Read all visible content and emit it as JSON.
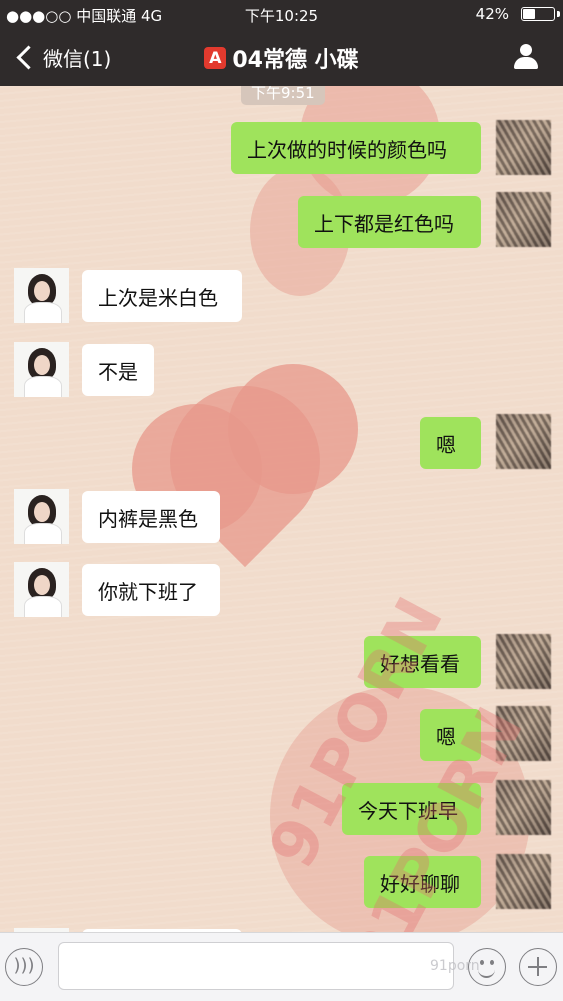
{
  "status_bar": {
    "carrier": "●●●○○ 中国联通   4G",
    "time": "下午10:25",
    "battery": "42%",
    "battery_level": 0.42
  },
  "nav": {
    "back_label": "微信(1)",
    "badge": "A",
    "title": "04常德 小碟"
  },
  "chat": {
    "timestamp": "下午9:51",
    "messages": [
      {
        "side": "out",
        "text": "上次做的时候的颜色吗"
      },
      {
        "side": "out",
        "text": "上下都是红色吗"
      },
      {
        "side": "in",
        "text": "上次是米白色"
      },
      {
        "side": "in",
        "text": "不是"
      },
      {
        "side": "out",
        "text": "嗯"
      },
      {
        "side": "in",
        "text": "内裤是黑色"
      },
      {
        "side": "in",
        "text": "你就下班了"
      },
      {
        "side": "out",
        "text": "好想看看"
      },
      {
        "side": "out",
        "text": "嗯"
      },
      {
        "side": "out",
        "text": "今天下班早"
      },
      {
        "side": "out",
        "text": "好好聊聊"
      }
    ]
  },
  "watermark": {
    "text1": "91PORN",
    "text2": "91PORN",
    "small": "91porn"
  },
  "icons": {
    "back": "chevron-left-icon",
    "profile": "person-icon",
    "voice": "voice-icon",
    "emoji": "emoji-icon",
    "add": "plus-icon"
  },
  "colors": {
    "outgoing_bubble": "#9fe35c",
    "incoming_bubble": "#ffffff",
    "nav_bg": "#2f2b2b"
  }
}
